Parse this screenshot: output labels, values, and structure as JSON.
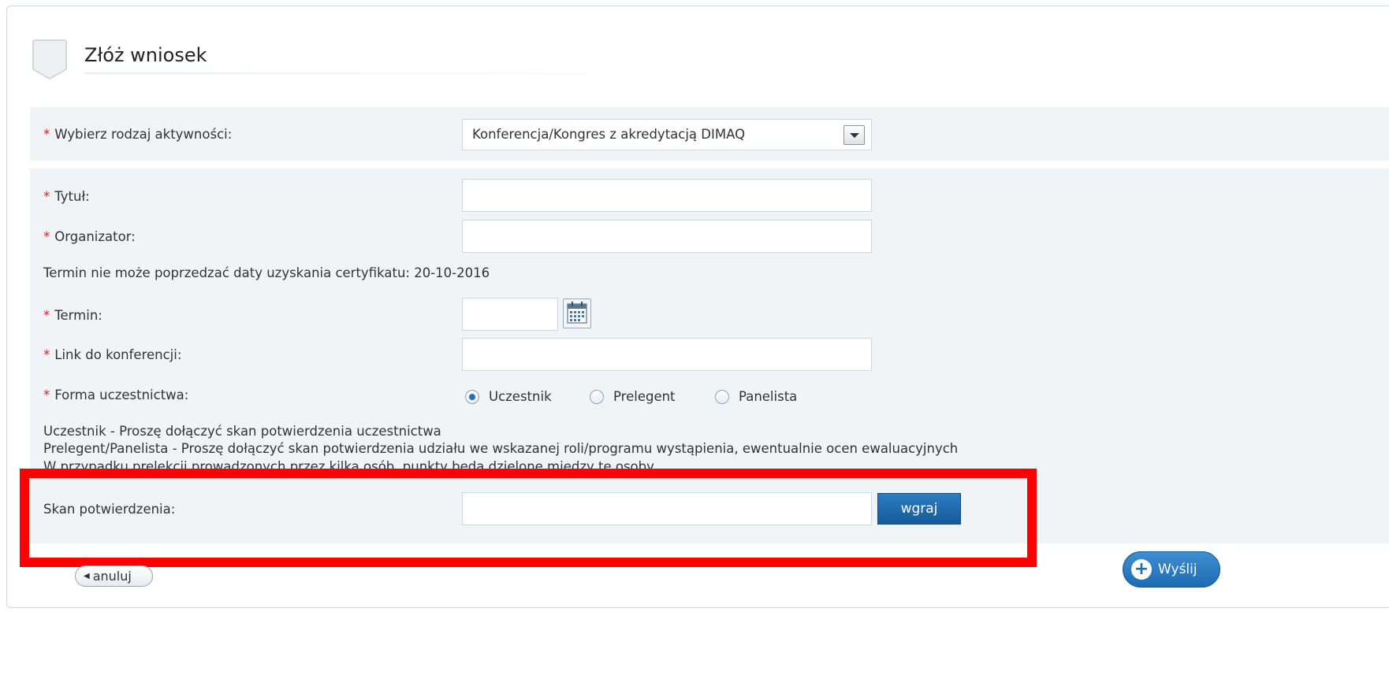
{
  "page": {
    "title": "Złóż wniosek"
  },
  "activity": {
    "required_mark": "*",
    "label": "Wybierz rodzaj aktywności:",
    "selected": "Konferencja/Kongres z akredytacją DIMAQ"
  },
  "form": {
    "title_label": "Tytuł:",
    "organizer_label": "Organizator:",
    "date_notice": "Termin nie może poprzedzać daty uzyskania certyfikatu: 20-10-2016",
    "date_label": "Termin:",
    "link_label": "Link do konferencji:",
    "participation_label": "Forma uczestnictwa:",
    "participation_options": [
      "Uczestnik",
      "Prelegent",
      "Panelista"
    ],
    "participation_selected": "Uczestnik",
    "info_lines": [
      "Uczestnik - Proszę dołączyć skan potwierdzenia uczestnictwa",
      "Prelegent/Panelista - Proszę dołączyć skan potwierdzenia udziału we wskazanej roli/programu wystąpienia, ewentualnie ocen ewaluacyjnych",
      "W przypadku prelekcji prowadzonych przez kilka osób, punkty będą dzielone między te osoby"
    ],
    "scan_label": "Skan potwierdzenia:",
    "upload_button": "wgraj"
  },
  "actions": {
    "cancel": "anuluj",
    "submit": "Wyślij"
  },
  "colors": {
    "highlight": "#ff0000",
    "required": "#e02020",
    "primary_button": "#1d6bb1"
  }
}
